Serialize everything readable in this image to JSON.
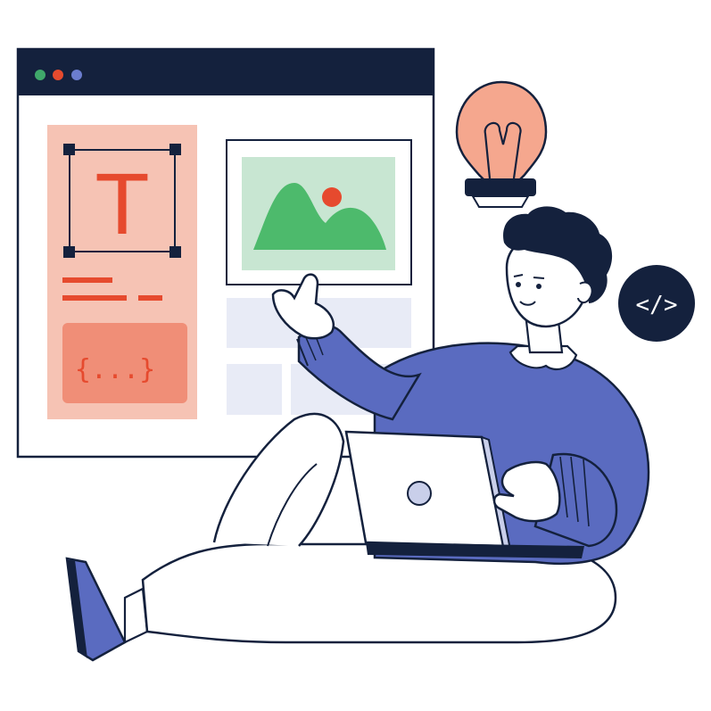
{
  "window": {
    "titlebar_color": "#14213d",
    "dots": [
      {
        "name": "green-dot",
        "color": "#3fa86a"
      },
      {
        "name": "red-dot",
        "color": "#e64a2e"
      },
      {
        "name": "blue-dot",
        "color": "#6b7dcf"
      }
    ]
  },
  "editor_panel": {
    "text_glyph": "T",
    "code_glyph": "{...}",
    "accent": "#e64a2e",
    "panel_color": "#f6c3b4"
  },
  "image_card": {
    "sky_color": "#c8e6d2",
    "mountain_color": "#4dba6c",
    "sun_color": "#e64a2e"
  },
  "badge": {
    "code_symbol": "</>",
    "color": "#14213d"
  },
  "icons": [
    "text-tool-icon",
    "code-block-icon",
    "image-icon",
    "lightbulb-icon",
    "code-badge-icon",
    "laptop-icon"
  ],
  "person": {
    "sweater_color": "#5a6bc0",
    "hair_color": "#14213d"
  }
}
